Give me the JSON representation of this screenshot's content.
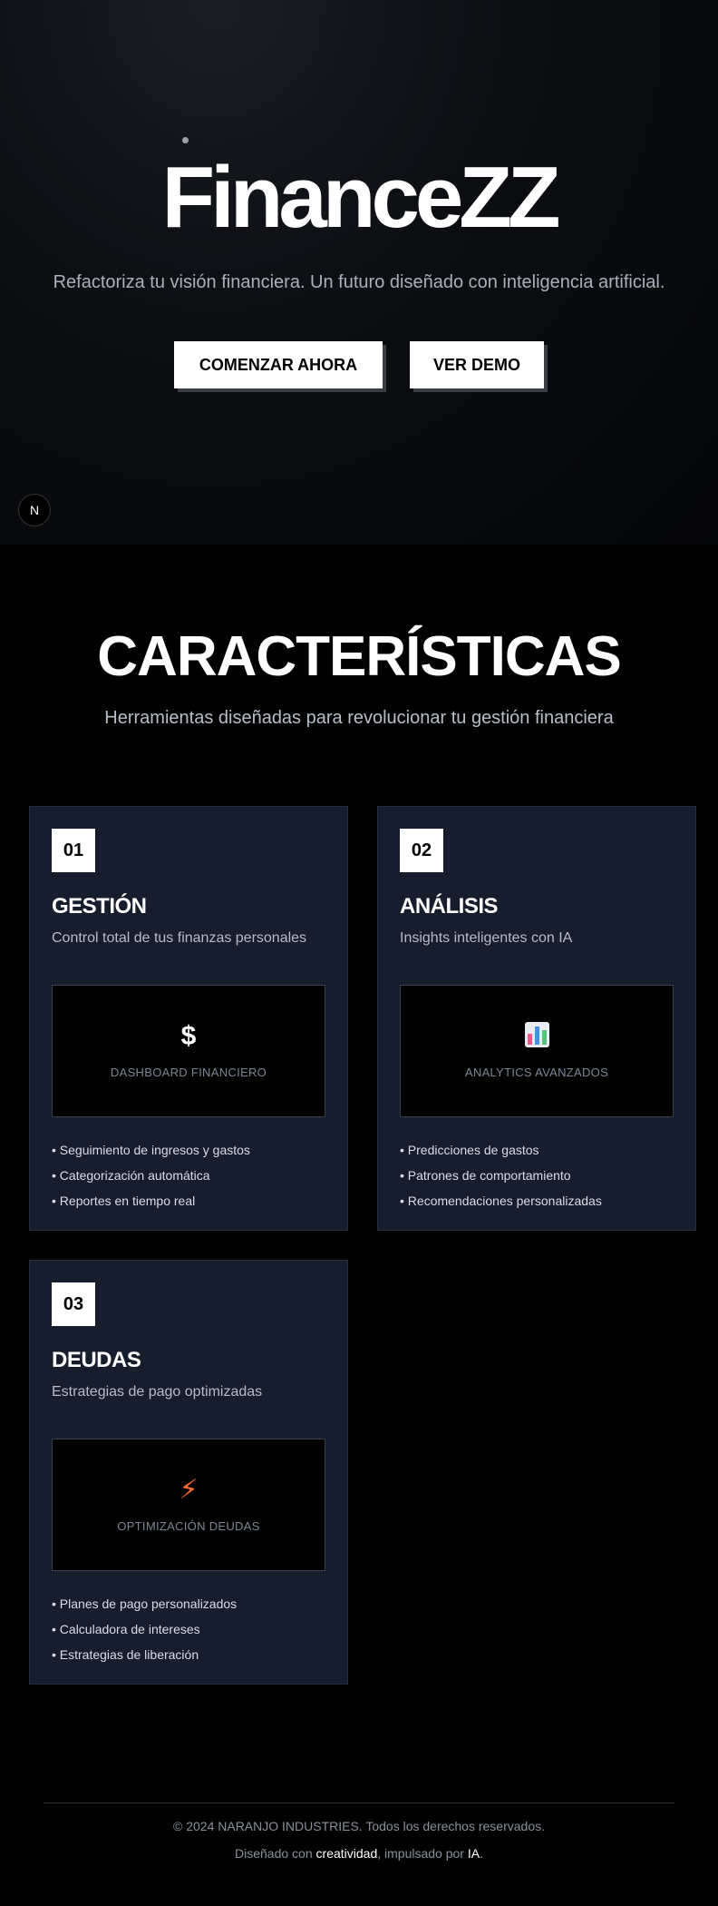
{
  "hero": {
    "brand": "FinanceZZ",
    "tagline": "Refactoriza tu visión financiera. Un futuro diseñado con inteligencia artificial.",
    "buttons": {
      "start": "COMENZAR AHORA",
      "demo": "VER DEMO"
    },
    "badge": "N"
  },
  "features": {
    "title": "CARACTERÍSTICAS",
    "subtitle": "Herramientas diseñadas para revolucionar tu gestión financiera",
    "cards": [
      {
        "number": "01",
        "title": "GESTIÓN",
        "description": "Control total de tus finanzas personales",
        "preview_icon": "$",
        "preview_label": "DASHBOARD FINANCIERO",
        "items": [
          "Seguimiento de ingresos y gastos",
          "Categorización automática",
          "Reportes en tiempo real"
        ]
      },
      {
        "number": "02",
        "title": "ANÁLISIS",
        "description": "Insights inteligentes con IA",
        "preview_icon": "bar-chart-icon",
        "preview_label": "ANALYTICS AVANZADOS",
        "items": [
          "Predicciones de gastos",
          "Patrones de comportamiento",
          "Recomendaciones personalizadas"
        ]
      },
      {
        "number": "03",
        "title": "DEUDAS",
        "description": "Estrategias de pago optimizadas",
        "preview_icon": "⚡",
        "preview_label": "OPTIMIZACIÓN DEUDAS",
        "items": [
          "Planes de pago personalizados",
          "Calculadora de intereses",
          "Estrategias de liberación"
        ]
      }
    ]
  },
  "footer": {
    "copyright": "© 2024 NARANJO INDUSTRIES. Todos los derechos reservados.",
    "made_prefix": "Diseñado con ",
    "made_highlight1": "creatividad",
    "made_middle": ", impulsado por ",
    "made_highlight2": "IA",
    "made_suffix": "."
  },
  "colors": {
    "background": "#000000",
    "card": "#161e2e",
    "accent_bolt": "#ff6a2a"
  }
}
